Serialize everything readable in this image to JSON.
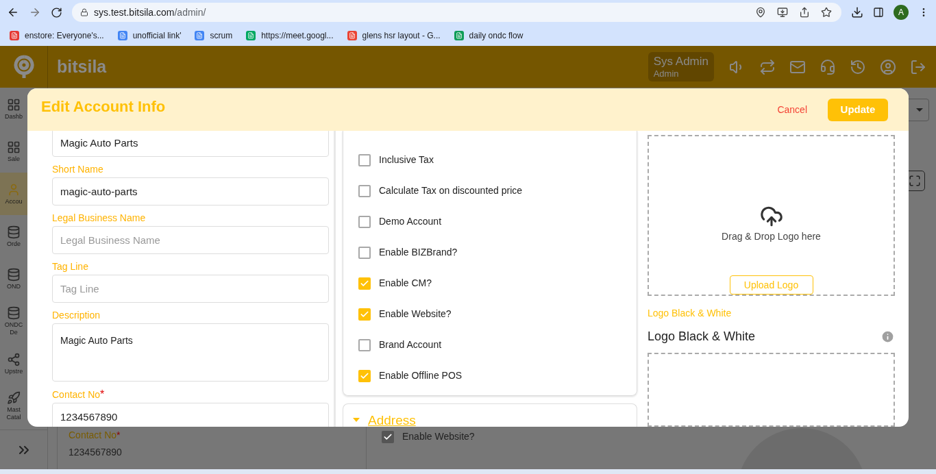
{
  "browser": {
    "url_host": "sys.test.bitsila.com",
    "url_path": "/admin/",
    "profile_initial": "A",
    "bookmarks": [
      {
        "label": "enstore: Everyone's...",
        "color": "#e53935"
      },
      {
        "label": "unofficial link'",
        "color": "#4285f4"
      },
      {
        "label": "scrum",
        "color": "#4285f4"
      },
      {
        "label": "https://meet.googl...",
        "color": "#00a862"
      },
      {
        "label": "glens hsr layout - G...",
        "color": "#ea4335"
      },
      {
        "label": "daily ondc flow",
        "color": "#0f9d58"
      }
    ]
  },
  "app_header": {
    "brand": "bitsila",
    "user_name": "Sys Admin",
    "user_role": "Admin"
  },
  "sidebar": {
    "items": [
      {
        "label": "Dashb",
        "selected": false
      },
      {
        "label": "Sale",
        "selected": false
      },
      {
        "label": "Accou",
        "selected": true
      },
      {
        "label": "Orde",
        "selected": false
      },
      {
        "label": "OND",
        "selected": false
      },
      {
        "label": "ONDC De",
        "selected": false
      },
      {
        "label": "Upstre",
        "selected": false
      },
      {
        "label": "Mast Catal",
        "selected": false
      }
    ]
  },
  "background_form": {
    "contact_label": "Contact No",
    "contact_mark": "*",
    "contact_value": "1234567890",
    "checkbox": {
      "label": "Enable Website?",
      "checked": true
    }
  },
  "dialog": {
    "title": "Edit Account Info",
    "cancel": "Cancel",
    "update": "Update",
    "fields": [
      {
        "kind": "input",
        "value": "Magic Auto Parts"
      },
      {
        "kind": "input",
        "label": "Short Name",
        "value": "magic-auto-parts"
      },
      {
        "kind": "input",
        "label": "Legal Business Name",
        "placeholder": "Legal Business Name"
      },
      {
        "kind": "input",
        "label": "Tag Line",
        "placeholder": "Tag Line"
      },
      {
        "kind": "textarea",
        "label": "Description",
        "value": "Magic Auto Parts"
      },
      {
        "kind": "input",
        "label": "Contact No",
        "required_mark": "*",
        "value": "1234567890"
      }
    ],
    "options": [
      {
        "label": "Inclusive Tax",
        "checked": false
      },
      {
        "label": "Calculate Tax on discounted price",
        "checked": false
      },
      {
        "label": "Demo Account",
        "checked": false
      },
      {
        "label": "Enable BIZBrand?",
        "checked": false
      },
      {
        "label": "Enable CM?",
        "checked": true
      },
      {
        "label": "Enable Website?",
        "checked": true
      },
      {
        "label": "Brand Account",
        "checked": false
      },
      {
        "label": "Enable Offline POS",
        "checked": true
      }
    ],
    "address_section": {
      "title": "Address",
      "expanded": true
    },
    "logo_upload": {
      "hint": "Drag & Drop Logo here",
      "button": "Upload Logo"
    },
    "logo_bw": {
      "label": "Logo Black & White",
      "title": "Logo Black & White"
    }
  }
}
